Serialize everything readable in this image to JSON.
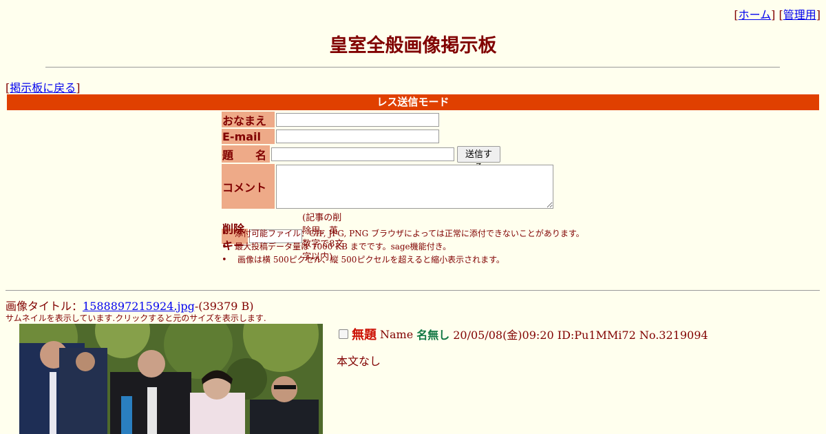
{
  "nav": {
    "home": "ホーム",
    "admin": "管理用"
  },
  "board_title": "皇室全般画像掲示板",
  "back_link": "掲示板に戻る",
  "mode_bar": "レス送信モード",
  "form": {
    "name_label": "おなまえ",
    "email_label": "E-mail",
    "subject_label": "題　　名",
    "comment_label": "コメント",
    "delkey_label": "削除キー",
    "submit_label": "送信する",
    "delkey_note": "(記事の削除用。英数字で8文字以内)",
    "name_value": "",
    "email_value": "",
    "subject_value": "",
    "comment_value": "",
    "delkey_value": ""
  },
  "rules": [
    "添付可能ファイル：GIF, JPG, PNG ブラウザによっては正常に添付できないことがあります。",
    "最大投稿データ量は 1000 KB までです。sage機能付き。",
    "画像は横 500ピクセル、縦 500ピクセルを超えると縮小表示されます。"
  ],
  "post": {
    "image_title_prefix": "画像タイトル：",
    "file_name": "1588897215924.jpg",
    "file_size": "-(39379 B)",
    "thumb_note": "サムネイルを表示しています.クリックすると元のサイズを表示します.",
    "subject": "無題",
    "name_label": "Name",
    "name": "名無し",
    "datetime_id": "20/05/08(金)09:20 ID:Pu1MMi72 No.3219094",
    "body": "本文なし"
  },
  "colors": {
    "background": "#ffffee",
    "text": "#800000",
    "mode_bar": "#e04000",
    "label_bg": "#eeaa88",
    "subject": "#cc1105",
    "name": "#117743",
    "link": "#0000ee"
  }
}
